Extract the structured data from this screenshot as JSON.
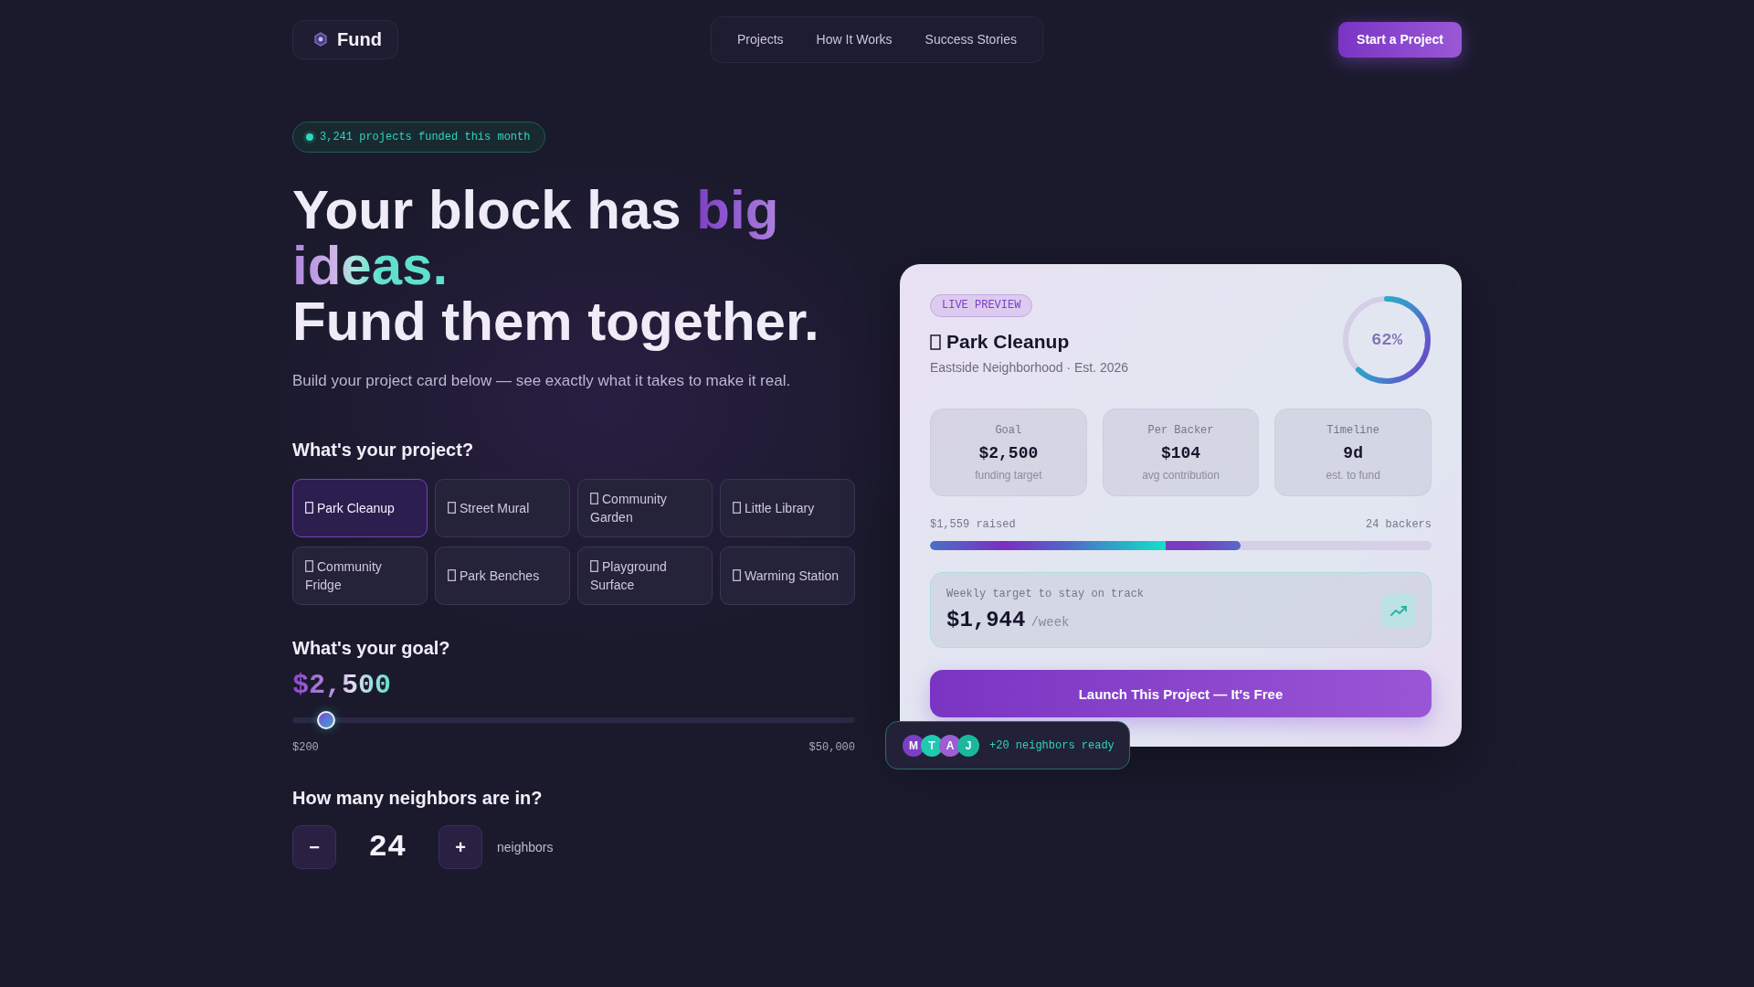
{
  "header": {
    "logo_text": "Fund",
    "nav": [
      "Projects",
      "How It Works",
      "Success Stories"
    ],
    "cta": "Start a Project"
  },
  "hero": {
    "badge": "3,241 projects funded this month",
    "headline": [
      {
        "parts": [
          {
            "text": "Your block has ",
            "accent": false
          },
          {
            "text": "big ideas.",
            "accent": true
          }
        ]
      },
      {
        "parts": [
          {
            "text": "Fund them together.",
            "accent": false
          }
        ]
      }
    ],
    "subtitle": "Build your project card below — see exactly what it takes to make it real."
  },
  "project": {
    "heading": "What's your project?",
    "options": [
      {
        "label": "Park Cleanup",
        "selected": true
      },
      {
        "label": "Street Mural",
        "selected": false
      },
      {
        "label": "Community Garden",
        "selected": false
      },
      {
        "label": "Little Library",
        "selected": false
      },
      {
        "label": "Community Fridge",
        "selected": false
      },
      {
        "label": "Park Benches",
        "selected": false
      },
      {
        "label": "Playground Surface",
        "selected": false
      },
      {
        "label": "Warming Station",
        "selected": false
      }
    ]
  },
  "goal": {
    "heading": "What's your goal?",
    "value": "$2,500",
    "slider": {
      "level": 0.046
    },
    "min_label": "$200",
    "max_label": "$50,000"
  },
  "neighbors": {
    "heading": "How many neighbors are in?",
    "decrement": "−",
    "count": "24",
    "increment": "+",
    "unit": "neighbors"
  },
  "preview_card": {
    "badge": "LIVE PREVIEW",
    "title": "Park Cleanup",
    "subtitle": "Eastside Neighborhood · Est. 2026",
    "ring": {
      "level": 0.62,
      "label": "62%"
    },
    "stats": [
      {
        "label": "Goal",
        "value": "$2,500",
        "caption": "funding target"
      },
      {
        "label": "Per Backer",
        "value": "$104",
        "caption": "avg contribution"
      },
      {
        "label": "Timeline",
        "value": "9d",
        "caption": "est. to fund"
      }
    ],
    "progress": {
      "raised": "$1,559 raised",
      "backers": "24 backers",
      "level": 0.62
    },
    "weekly": {
      "label": "Weekly target to stay on track",
      "value": "$1,944",
      "unit": "/week"
    },
    "launch_button": "Launch This Project — It's Free"
  },
  "neighbors_chip": {
    "avatars": [
      {
        "initial": "M",
        "color": "#7b3fc4"
      },
      {
        "initial": "T",
        "color": "#1fc9b0"
      },
      {
        "initial": "A",
        "color": "#9b5fd2"
      },
      {
        "initial": "J",
        "color": "#1bb89c"
      }
    ],
    "text": "+20 neighbors ready"
  }
}
